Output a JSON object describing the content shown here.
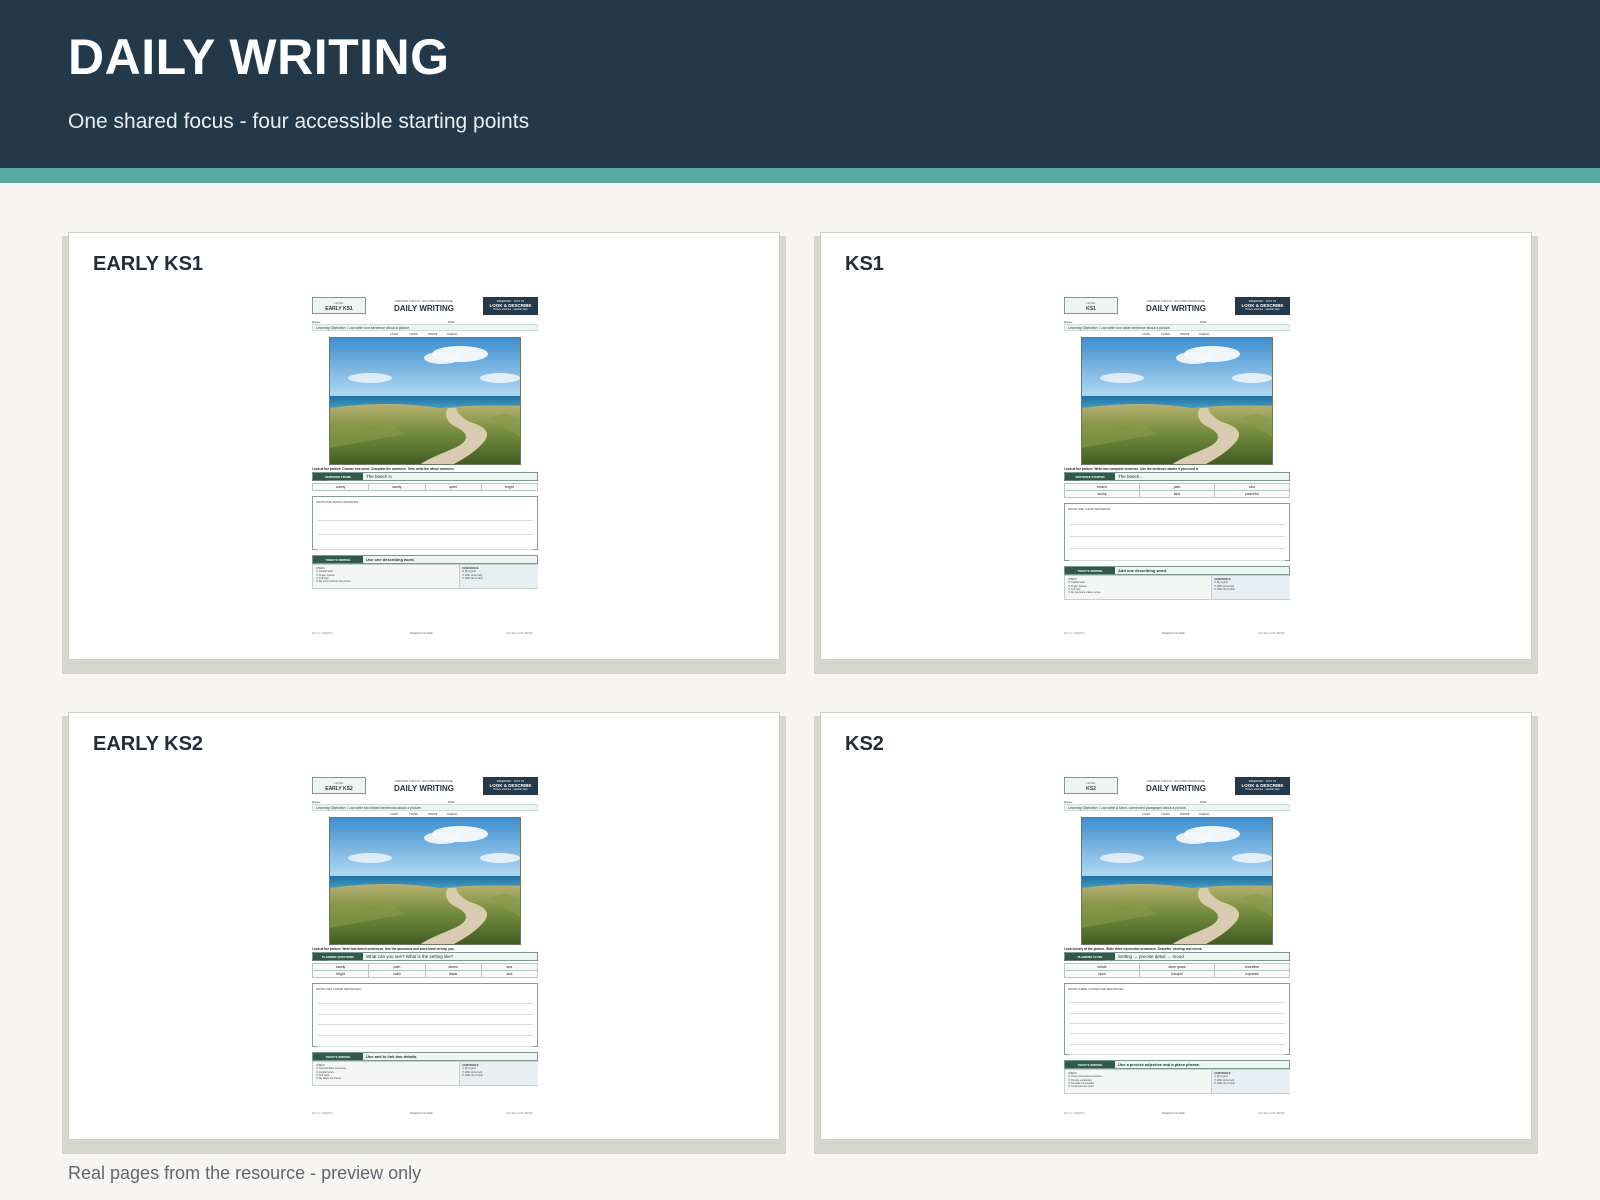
{
  "header": {
    "title": "DAILY WRITING",
    "subtitle": "One shared focus - four accessible starting points"
  },
  "footer_note": "Real pages from the resource - preview only",
  "cards": [
    {
      "title": "EARLY KS1",
      "sheet": {
        "level_caption": "LEVEL",
        "level": "EARLY KS1",
        "strap": "WRITING FOCUS · PICTURE RESPONSE",
        "title": "DAILY WRITING",
        "day_line": "WEEKDAY · DAY 01",
        "badge": "LOOK & DESCRIBE",
        "badge_sub": "Picture stimulus · seaside path",
        "name_label": "Name:",
        "date_label": "Date:",
        "objective": "Learning Objective: I can write one sentence about a picture.",
        "steps": [
          "LOOK",
          "THINK",
          "WRITE",
          "CHECK"
        ],
        "instruction": "Look at the picture. Choose one word. Complete the sentence. Then write the whole sentence.",
        "prompt_tag": "SENTENCE FRAME",
        "prompt": "The beach is",
        "word_caption": "WORD BANK",
        "words": [
          "sunny",
          "sandy",
          "quiet",
          "bright"
        ],
        "write_caption": "WRITE THE WHOLE SENTENCE",
        "goal_tag": "TODAY'S WRITING",
        "goal": "Use one describing word.",
        "check_caption": "CHECK",
        "checks": [
          "Capital letter",
          "Finger spaces",
          "Full stop",
          "My word matches the picture"
        ],
        "conf_caption": "CONFIDENCE",
        "conf": [
          "By myself",
          "With some help",
          "With lots of help"
        ],
        "foot_left": "DAY 01 · WEEKDAY",
        "foot_mid": "Designed by Mr Smith",
        "foot_right": "NEW ENGLAND LIBRARY"
      }
    },
    {
      "title": "KS1",
      "sheet": {
        "level_caption": "LEVEL",
        "level": "KS1",
        "strap": "WRITING FOCUS · PICTURE RESPONSE",
        "title": "DAILY WRITING",
        "day_line": "WEEKDAY · DAY 01",
        "badge": "LOOK & DESCRIBE",
        "badge_sub": "Picture stimulus · seaside path",
        "name_label": "Name:",
        "date_label": "Date:",
        "objective": "Learning Objective: I can write one clear sentence about a picture.",
        "steps": [
          "LOOK",
          "THINK",
          "WRITE",
          "CHECK"
        ],
        "instruction": "Look at the picture. Write one complete sentence. Use the sentence starter if you need it.",
        "prompt_tag": "SENTENCE STARTER",
        "prompt": "The beach...",
        "word_caption": "WORD BANK",
        "words": [
          "beach",
          "path",
          "sea",
          "sunny",
          "blue",
          "peaceful"
        ],
        "write_caption": "WRITE ONE CLEAR SENTENCE",
        "goal_tag": "TODAY'S WRITING",
        "goal": "Add one describing word.",
        "check_caption": "CHECK",
        "checks": [
          "Capital letter",
          "Finger spaces",
          "Full stop",
          "My sentence makes sense"
        ],
        "conf_caption": "CONFIDENCE",
        "conf": [
          "By myself",
          "With some help",
          "With lots of help"
        ],
        "foot_left": "DAY 01 · WEEKDAY",
        "foot_mid": "Designed by Mr Smith",
        "foot_right": "NEW ENGLAND LIBRARY"
      }
    },
    {
      "title": "EARLY KS2",
      "sheet": {
        "level_caption": "LEVEL",
        "level": "EARLY KS2",
        "strap": "WRITING FOCUS · PICTURE RESPONSE",
        "title": "DAILY WRITING",
        "day_line": "WEEKDAY · DAY 01",
        "badge": "LOOK & DESCRIBE",
        "badge_sub": "Picture stimulus · seaside path",
        "name_label": "Name:",
        "date_label": "Date:",
        "objective": "Learning Objective: I can write two linked sentences about a picture.",
        "steps": [
          "LOOK",
          "THINK",
          "WRITE",
          "CHECK"
        ],
        "instruction": "Look at the picture. Write two linked sentences. Use the questions and word bank to help you.",
        "prompt_tag": "PLANNING QUESTIONS",
        "prompt": "What can you see? What is the setting like?",
        "word_caption": "WORD BANK",
        "words": [
          "sandy",
          "path",
          "dunes",
          "sea",
          "bright",
          "calm",
          "leads",
          "and"
        ],
        "write_caption": "WRITE TWO LINKED SENTENCES",
        "goal_tag": "TODAY'S WRITING",
        "goal": "Use and to link two details.",
        "check_caption": "CHECK",
        "checks": [
          "Two complete sentences",
          "Capital letters",
          "Full stops",
          "My ideas are linked"
        ],
        "conf_caption": "CONFIDENCE",
        "conf": [
          "By myself",
          "With some help",
          "With lots of help"
        ],
        "foot_left": "DAY 01 · WEEKDAY",
        "foot_mid": "Designed by Mr Smith",
        "foot_right": "NEW ENGLAND LIBRARY"
      }
    },
    {
      "title": "KS2",
      "sheet": {
        "level_caption": "LEVEL",
        "level": "KS2",
        "strap": "WRITING FOCUS · PICTURE RESPONSE",
        "title": "DAILY WRITING",
        "day_line": "WEEKDAY · DAY 01",
        "badge": "LOOK & DESCRIBE",
        "badge_sub": "Picture stimulus · seaside path",
        "name_label": "Name:",
        "date_label": "Date:",
        "objective": "Learning Objective: I can write a short, connected paragraph about a picture.",
        "steps": [
          "LOOK",
          "THINK",
          "WRITE",
          "CHECK"
        ],
        "instruction": "Look closely at the picture. Write three connected sentences. Describe, develop and check.",
        "prompt_tag": "PLANNING CLUES",
        "prompt": "Setting → precise detail → mood",
        "word_caption": "OPTIONAL PRECISION WORDS",
        "words": [
          "winds",
          "dune grass",
          "shoreline",
          "open",
          "tranquil",
          "expanse"
        ],
        "write_caption": "WRITE THREE CONNECTED SENTENCES",
        "goal_tag": "TODAY'S WRITING",
        "goal": "Use a precise adjective and a place phrase.",
        "check_caption": "CHECK",
        "checks": [
          "Three connected sentences",
          "Precise vocabulary",
          "Accurate punctuation",
          "I improved one word"
        ],
        "conf_caption": "CONFIDENCE",
        "conf": [
          "By myself",
          "With some help",
          "With lots of help"
        ],
        "foot_left": "DAY 01 · WEEKDAY",
        "foot_mid": "Designed by Mr Smith",
        "foot_right": "NEW ENGLAND LIBRARY"
      }
    }
  ]
}
